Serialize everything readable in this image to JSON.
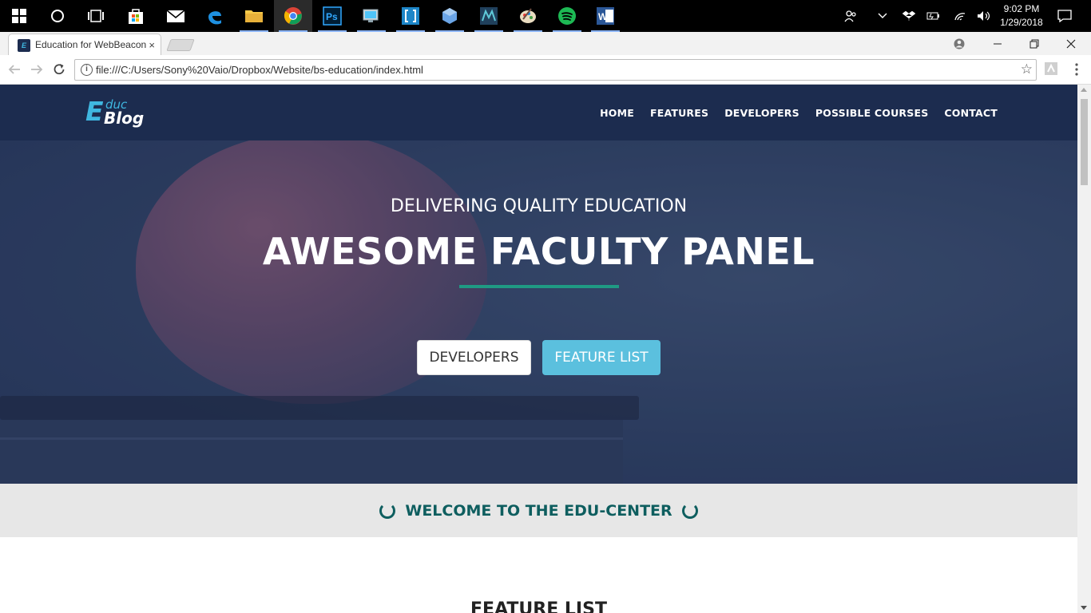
{
  "taskbar": {
    "apps": [
      "start-menu",
      "cortana",
      "task-view",
      "store",
      "mail",
      "edge",
      "file-explorer",
      "chrome",
      "photoshop",
      "control-panel",
      "brackets",
      "virtualbox",
      "maya",
      "paint",
      "spotify",
      "word"
    ],
    "clock_time": "9:02 PM",
    "clock_date": "1/29/2018"
  },
  "browser": {
    "tab_title": "Education for WebBeacon",
    "tab_favicon": "E",
    "tab_close": "×",
    "url": "file:///C:/Users/Sony%20Vaio/Dropbox/Website/bs-education/index.html",
    "info_glyph": "i"
  },
  "site": {
    "logo": {
      "e": "E",
      "educ": "duc",
      "blog": "Blog"
    },
    "nav": [
      "HOME",
      "FEATURES",
      "DEVELOPERS",
      "POSSIBLE COURSES",
      "CONTACT"
    ],
    "hero": {
      "subtitle": "DELIVERING QUALITY EDUCATION",
      "title": "AWESOME FACULTY PANEL",
      "btn_developers": "DEVELOPERS",
      "btn_features": "FEATURE LIST"
    },
    "welcome": "WELCOME TO THE EDU-CENTER",
    "feature_heading": "FEATURE LIST"
  },
  "colors": {
    "navbar": "#1c2c4f",
    "accent_teal": "#1f9a83",
    "button_info": "#5bc0de",
    "welcome_text": "#0e5e5f"
  }
}
